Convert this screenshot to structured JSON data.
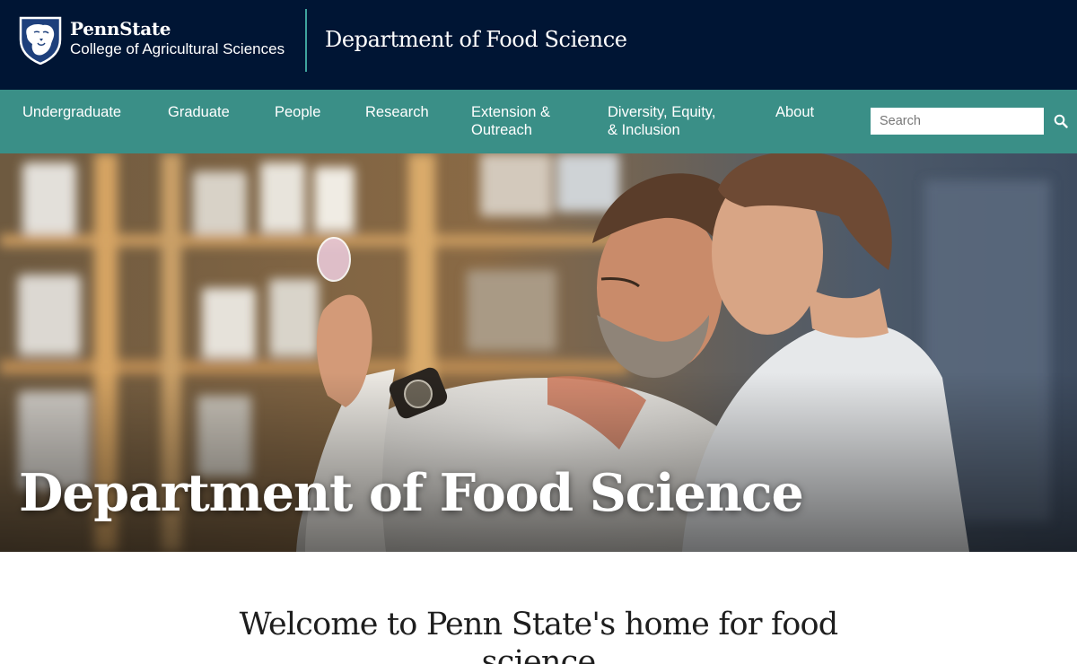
{
  "header": {
    "university": "PennState",
    "college": "College of Agricultural Sciences",
    "department": "Department of Food Science"
  },
  "nav": {
    "items": [
      {
        "label": "Undergraduate"
      },
      {
        "label": "Graduate"
      },
      {
        "label": "People"
      },
      {
        "label": "Research"
      },
      {
        "label": "Extension &\nOutreach"
      },
      {
        "label": "Diversity, Equity,\n& Inclusion"
      },
      {
        "label": "About"
      }
    ],
    "search": {
      "placeholder": "Search",
      "value": "",
      "icon": "search-icon"
    }
  },
  "hero": {
    "title": "Department of Food Science",
    "image": "hero-photo-lab-scientists"
  },
  "intro": {
    "heading": "Welcome to Penn State's home for food science"
  },
  "colors": {
    "header_bg": "#001534",
    "nav_bg": "#3a8f87",
    "accent": "#3ea39e",
    "text_white": "#ffffff"
  }
}
